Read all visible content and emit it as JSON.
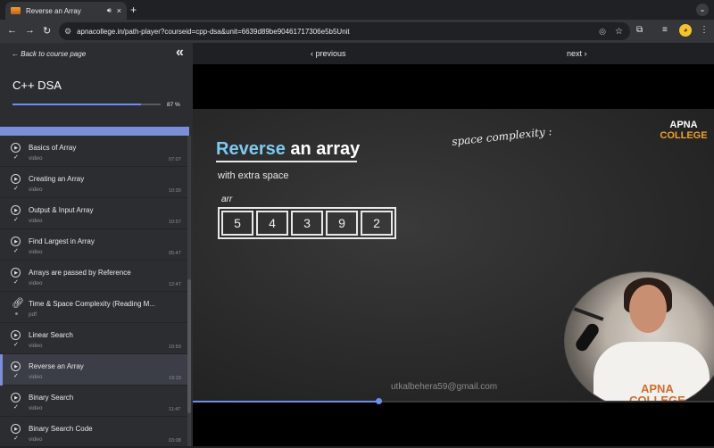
{
  "browser": {
    "tab_title": "Reverse an Array",
    "tab_audio_icon": "speaker-icon",
    "tab_close": "×",
    "new_tab": "+",
    "tab_menu": "⌄",
    "url": "apnacollege.in/path-player?courseid=cpp-dsa&unit=6639d89be90461717306e5b5Unit",
    "back": "←",
    "forward": "→",
    "reload": "↻",
    "avatar_initial": "◕"
  },
  "sidebar": {
    "back_link": "← Back to course page",
    "collapse": "«",
    "course_title": "C++ DSA",
    "progress_percent": 87,
    "progress_label": "87 %",
    "lessons": [
      {
        "name": "Basics of Array",
        "kind": "video",
        "duration": "07:07",
        "type": "video"
      },
      {
        "name": "Creating an Array",
        "kind": "video",
        "duration": "10:30",
        "type": "video"
      },
      {
        "name": "Output & Input Array",
        "kind": "video",
        "duration": "10:57",
        "type": "video"
      },
      {
        "name": "Find Largest in Array",
        "kind": "video",
        "duration": "05:47",
        "type": "video"
      },
      {
        "name": "Arrays are passed by Reference",
        "kind": "video",
        "duration": "12:47",
        "type": "video"
      },
      {
        "name": "Time & Space Complexity (Reading M...",
        "kind": "pdf",
        "duration": "",
        "type": "pdf"
      },
      {
        "name": "Linear Search",
        "kind": "video",
        "duration": "10:59",
        "type": "video"
      },
      {
        "name": "Reverse an Array",
        "kind": "video",
        "duration": "19:19",
        "type": "video",
        "active": true
      },
      {
        "name": "Binary Search",
        "kind": "video",
        "duration": "11:47",
        "type": "video"
      },
      {
        "name": "Binary Search Code",
        "kind": "video",
        "duration": "03:08",
        "type": "video"
      }
    ]
  },
  "player": {
    "previous": "‹ previous",
    "next": "next ›",
    "slide_title_1": "Reverse",
    "slide_title_2": " an array",
    "slide_subtitle": "with extra space",
    "array_label": "arr",
    "array_values": [
      "5",
      "4",
      "3",
      "9",
      "2"
    ],
    "handwriting": "space complexity :",
    "logo_line1": "APNA",
    "logo_line2": "COLLEGE",
    "watermark": "utkalbehera59@gmail.com",
    "shirt_text_1": "APNA",
    "shirt_text_2": "COLLEGE",
    "seek_fraction": 0.356
  },
  "colors": {
    "accent": "#6f8ee8",
    "sidebar_bg": "#2b2d30",
    "logo_orange": "#f0a030"
  }
}
